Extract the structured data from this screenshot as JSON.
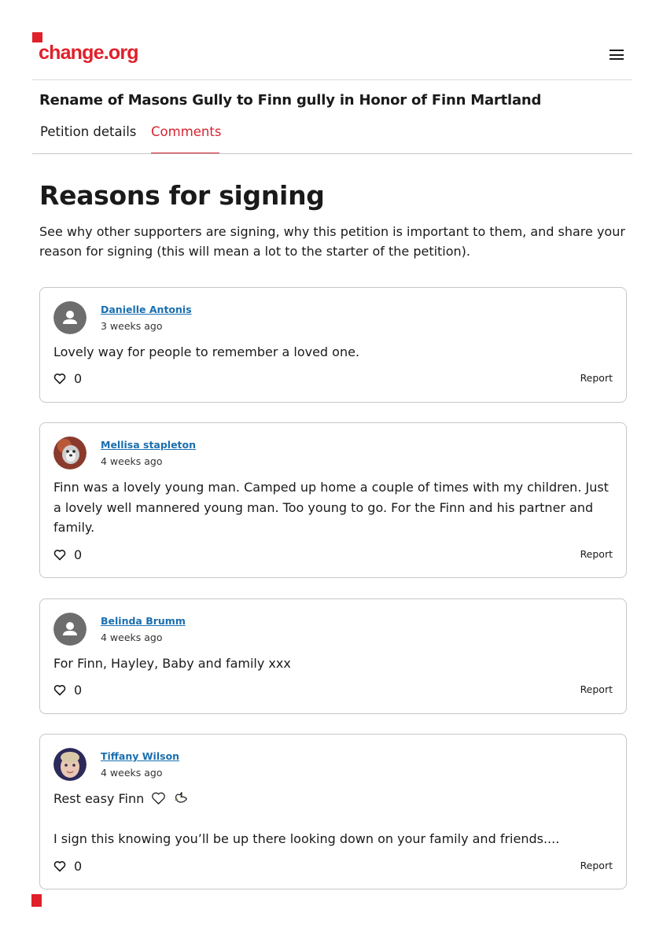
{
  "brand": {
    "logo_text": "change.org",
    "accent_color": "#e0202b"
  },
  "header": {
    "menu_icon": "hamburger-icon"
  },
  "petition": {
    "title": "Rename of Masons Gully to Finn gully in Honor of Finn Martland"
  },
  "tabs": [
    {
      "label": "Petition details",
      "active": false
    },
    {
      "label": "Comments",
      "active": true
    }
  ],
  "main": {
    "heading": "Reasons for signing",
    "intro": "See why other supporters are signing, why this petition is important to them, and share your reason for signing (this will mean a lot to the starter of the petition)."
  },
  "comments": [
    {
      "author": "Danielle Antonis",
      "time": "3 weeks ago",
      "text": "Lovely way for people to remember a loved one.",
      "likes": "0",
      "report_label": "Report",
      "avatar": "default-avatar-icon"
    },
    {
      "author": "Mellisa stapleton",
      "time": "4 weeks ago",
      "text": "Finn was a lovely young man. Camped up home a couple of times with my children. Just a lovely well mannered young man.  Too young to go. For the Finn and his partner and family.",
      "likes": "0",
      "report_label": "Report",
      "avatar": "user-photo"
    },
    {
      "author": "Belinda Brumm",
      "time": "4 weeks ago",
      "text": "For Finn, Hayley, Baby and family xxx",
      "likes": "0",
      "report_label": "Report",
      "avatar": "default-avatar-icon"
    },
    {
      "author": "Tiffany Wilson",
      "time": "4 weeks ago",
      "text_line1": "Rest easy Finn",
      "text_line2": "I sign this knowing you’ll be up there looking down on your family and friends....",
      "likes": "0",
      "report_label": "Report",
      "avatar": "user-photo"
    }
  ]
}
